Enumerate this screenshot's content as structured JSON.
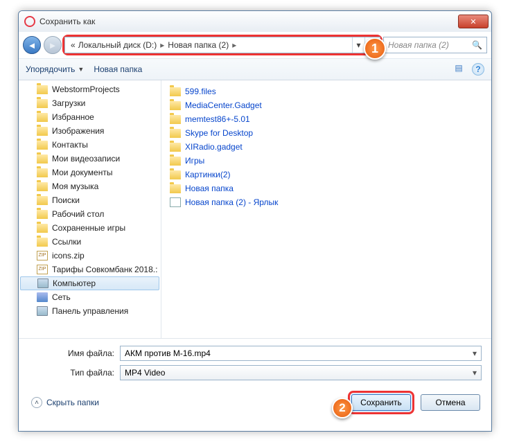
{
  "window": {
    "title": "Сохранить как"
  },
  "address": {
    "prefix": "«",
    "seg1": "Локальный диск (D:)",
    "seg2": "Новая папка (2)",
    "sep": "▸",
    "dropdown": "▾",
    "refresh": "↻"
  },
  "search": {
    "placeholder": "Новая папка (2)",
    "icon": "🔍"
  },
  "toolbar": {
    "organize": "Упорядочить",
    "newfolder": "Новая папка",
    "view_icon": "▤",
    "help_icon": "?"
  },
  "tree": [
    {
      "icon": "folder",
      "label": "WebstormProjects"
    },
    {
      "icon": "folder",
      "label": "Загрузки"
    },
    {
      "icon": "folder",
      "label": "Избранное"
    },
    {
      "icon": "folder",
      "label": "Изображения"
    },
    {
      "icon": "folder",
      "label": "Контакты"
    },
    {
      "icon": "folder",
      "label": "Мои видеозаписи"
    },
    {
      "icon": "folder",
      "label": "Мои документы"
    },
    {
      "icon": "folder",
      "label": "Моя музыка"
    },
    {
      "icon": "folder",
      "label": "Поиски"
    },
    {
      "icon": "folder",
      "label": "Рабочий стол"
    },
    {
      "icon": "folder",
      "label": "Сохраненные игры"
    },
    {
      "icon": "folder",
      "label": "Ссылки"
    },
    {
      "icon": "zip",
      "label": "icons.zip"
    },
    {
      "icon": "zip",
      "label": "Тарифы Совкомбанк 2018.:"
    },
    {
      "icon": "comp",
      "label": "Компьютер",
      "selected": true
    },
    {
      "icon": "net",
      "label": "Сеть"
    },
    {
      "icon": "comp",
      "label": "Панель управления"
    }
  ],
  "files": [
    {
      "icon": "folder",
      "name": "599.files"
    },
    {
      "icon": "folder",
      "name": "MediaCenter.Gadget"
    },
    {
      "icon": "folder",
      "name": "memtest86+-5.01"
    },
    {
      "icon": "folder",
      "name": "Skype for Desktop"
    },
    {
      "icon": "folder",
      "name": "XIRadio.gadget"
    },
    {
      "icon": "folder",
      "name": "Игры"
    },
    {
      "icon": "folder",
      "name": "Картинки(2)"
    },
    {
      "icon": "folder",
      "name": "Новая папка"
    },
    {
      "icon": "shortcut",
      "name": "Новая папка (2) - Ярлык"
    }
  ],
  "form": {
    "filename_label": "Имя файла:",
    "filename_value": "АКМ против М-16.mp4",
    "filetype_label": "Тип файла:",
    "filetype_value": "MP4 Video"
  },
  "footer": {
    "hide": "Скрыть папки",
    "save": "Сохранить",
    "cancel": "Отмена"
  },
  "badges": {
    "one": "1",
    "two": "2"
  }
}
